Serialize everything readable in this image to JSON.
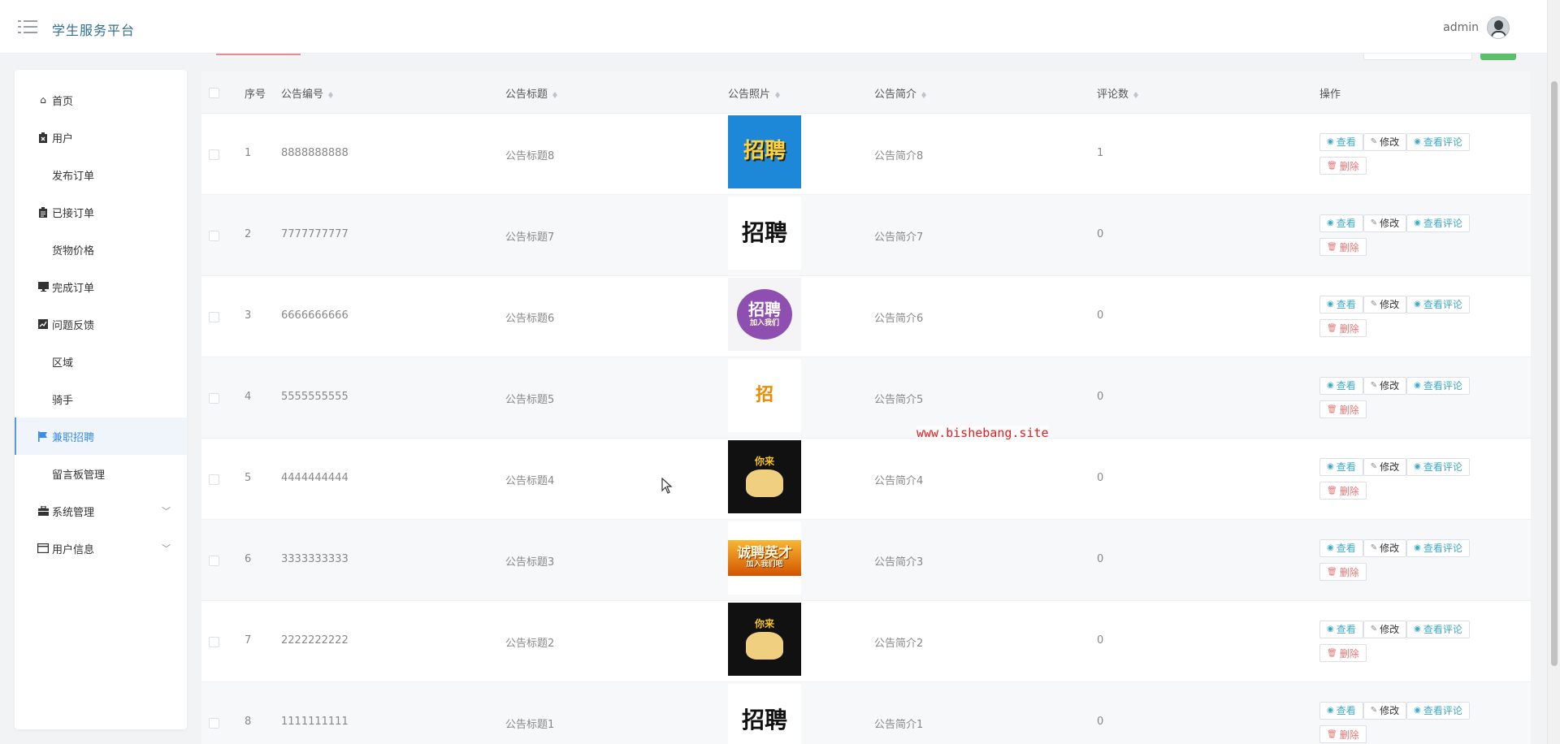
{
  "header": {
    "brand": "学生服务平台",
    "username": "admin"
  },
  "sidebar": {
    "items": [
      {
        "label": "首页",
        "icon": "home-icon"
      },
      {
        "label": "用户",
        "icon": "clipboard-x-icon"
      },
      {
        "label": "发布订单",
        "icon": "grid-icon"
      },
      {
        "label": "已接订单",
        "icon": "clipboard-icon"
      },
      {
        "label": "货物价格",
        "icon": "grid-icon"
      },
      {
        "label": "完成订单",
        "icon": "monitor-icon"
      },
      {
        "label": "问题反馈",
        "icon": "chart-icon"
      },
      {
        "label": "区域",
        "icon": "grid-icon"
      },
      {
        "label": "骑手",
        "icon": "grid-icon"
      },
      {
        "label": "兼职招聘",
        "icon": "flag-icon",
        "active": true
      },
      {
        "label": "留言板管理",
        "icon": "grid-icon"
      },
      {
        "label": "系统管理",
        "icon": "briefcase-icon",
        "expandable": true
      },
      {
        "label": "用户信息",
        "icon": "card-icon",
        "expandable": true
      }
    ]
  },
  "table": {
    "headers": {
      "index": "序号",
      "code": "公告编号",
      "title": "公告标题",
      "photo": "公告照片",
      "intro": "公告简介",
      "comments": "评论数",
      "ops": "操作"
    },
    "rows": [
      {
        "index": "1",
        "code": "8888888888",
        "title": "公告标题8",
        "intro": "公告简介8",
        "comments": "1",
        "photo": "招聘"
      },
      {
        "index": "2",
        "code": "7777777777",
        "title": "公告标题7",
        "intro": "公告简介7",
        "comments": "0",
        "photo": "招聘"
      },
      {
        "index": "3",
        "code": "6666666666",
        "title": "公告标题6",
        "intro": "公告简介6",
        "comments": "0",
        "photo": "招聘"
      },
      {
        "index": "4",
        "code": "5555555555",
        "title": "公告标题5",
        "intro": "公告简介5",
        "comments": "0",
        "photo": "招"
      },
      {
        "index": "5",
        "code": "4444444444",
        "title": "公告标题4",
        "intro": "公告简介4",
        "comments": "0",
        "photo": "你来"
      },
      {
        "index": "6",
        "code": "3333333333",
        "title": "公告标题3",
        "intro": "公告简介3",
        "comments": "0",
        "photo": "诚聘英才"
      },
      {
        "index": "7",
        "code": "2222222222",
        "title": "公告标题2",
        "intro": "公告简介2",
        "comments": "0",
        "photo": "你来"
      },
      {
        "index": "8",
        "code": "1111111111",
        "title": "公告标题1",
        "intro": "公告简介1",
        "comments": "0",
        "photo": "招聘"
      }
    ],
    "actions": {
      "view": "查看",
      "edit": "修改",
      "comments": "查看评论",
      "delete": "删除"
    }
  },
  "photo_captions": {
    "purple_sub": "加入我们",
    "orange_sub": "加入我们吧"
  },
  "watermark": "www.bishebang.site",
  "colors": {
    "brand": "#2f6f8f",
    "active": "#3a8ee6",
    "view": "#3fa9c9",
    "delete": "#e57373",
    "accent_green": "#5bbf6a"
  }
}
